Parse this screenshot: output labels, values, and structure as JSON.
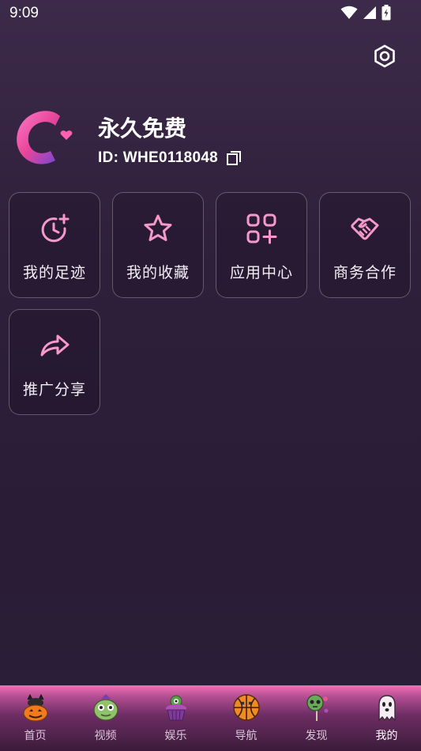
{
  "status_bar": {
    "time": "9:09"
  },
  "profile": {
    "name": "永久免费",
    "id_text": "ID: WHE0118048"
  },
  "menu": [
    {
      "label": "我的足迹",
      "icon": "history-add-icon"
    },
    {
      "label": "我的收藏",
      "icon": "star-icon"
    },
    {
      "label": "应用中心",
      "icon": "apps-add-icon"
    },
    {
      "label": "商务合作",
      "icon": "handshake-icon"
    },
    {
      "label": "推广分享",
      "icon": "share-icon"
    }
  ],
  "tabs": [
    {
      "label": "首页",
      "icon": "pumpkin-cat-icon",
      "active": false
    },
    {
      "label": "视频",
      "icon": "monster-icon",
      "active": false
    },
    {
      "label": "娱乐",
      "icon": "cupcake-icon",
      "active": false
    },
    {
      "label": "导航",
      "icon": "basketball-icon",
      "active": false
    },
    {
      "label": "发现",
      "icon": "lollipop-skull-icon",
      "active": false
    },
    {
      "label": "我的",
      "icon": "ghost-icon",
      "active": true
    }
  ],
  "colors": {
    "accent_pink": "#f36fb5",
    "icon_pink": "#f59ac8",
    "background": "#2e1f3a"
  }
}
